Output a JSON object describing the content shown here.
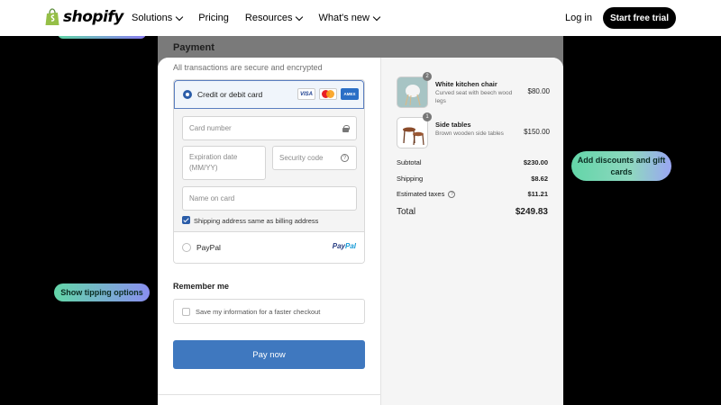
{
  "nav": {
    "brand": "shopify",
    "menu": [
      {
        "label": "Solutions",
        "dropdown": true
      },
      {
        "label": "Pricing",
        "dropdown": false
      },
      {
        "label": "Resources",
        "dropdown": true
      },
      {
        "label": "What's new",
        "dropdown": true
      }
    ],
    "login": "Log in",
    "cta": "Start free trial"
  },
  "payment": {
    "heading": "Payment",
    "secure_note": "All transactions are secure and encrypted",
    "card_option": {
      "label": "Credit or debit card",
      "selected": true,
      "brands": [
        "VISA",
        "Mastercard",
        "AMEX"
      ]
    },
    "fields": {
      "card_number": "Card number",
      "expiration_line1": "Expiration date",
      "expiration_line2": "(MM/YY)",
      "security_code": "Security code",
      "name_on_card": "Name on card"
    },
    "billing_same": {
      "label": "Shipping address same as billing address",
      "checked": true
    },
    "paypal": {
      "label": "PayPal",
      "logo_a": "Pay",
      "logo_b": "Pal",
      "selected": false
    }
  },
  "remember": {
    "heading": "Remember me",
    "label": "Save my information for a faster checkout",
    "checked": false
  },
  "pay_button": "Pay now",
  "summary": {
    "items": [
      {
        "name": "White kitchen chair",
        "desc": "Curved seat with beech wood legs",
        "price": "$80.00",
        "qty": "2"
      },
      {
        "name": "Side tables",
        "desc": "Brown wooden side tables",
        "price": "$150.00",
        "qty": "1"
      }
    ],
    "subtotal": {
      "label": "Subtotal",
      "value": "$230.00"
    },
    "shipping": {
      "label": "Shipping",
      "value": "$8.62"
    },
    "taxes": {
      "label": "Estimated taxes",
      "value": "$11.21"
    },
    "total": {
      "label": "Total",
      "value": "$249.83"
    }
  },
  "pills": {
    "discounts": "Add discounts and gift cards",
    "tipping": "Show tipping options"
  },
  "colors": {
    "accent": "#3f78bf",
    "pill_green": "#63d6a8",
    "pill_purple": "#8a8ff0"
  }
}
